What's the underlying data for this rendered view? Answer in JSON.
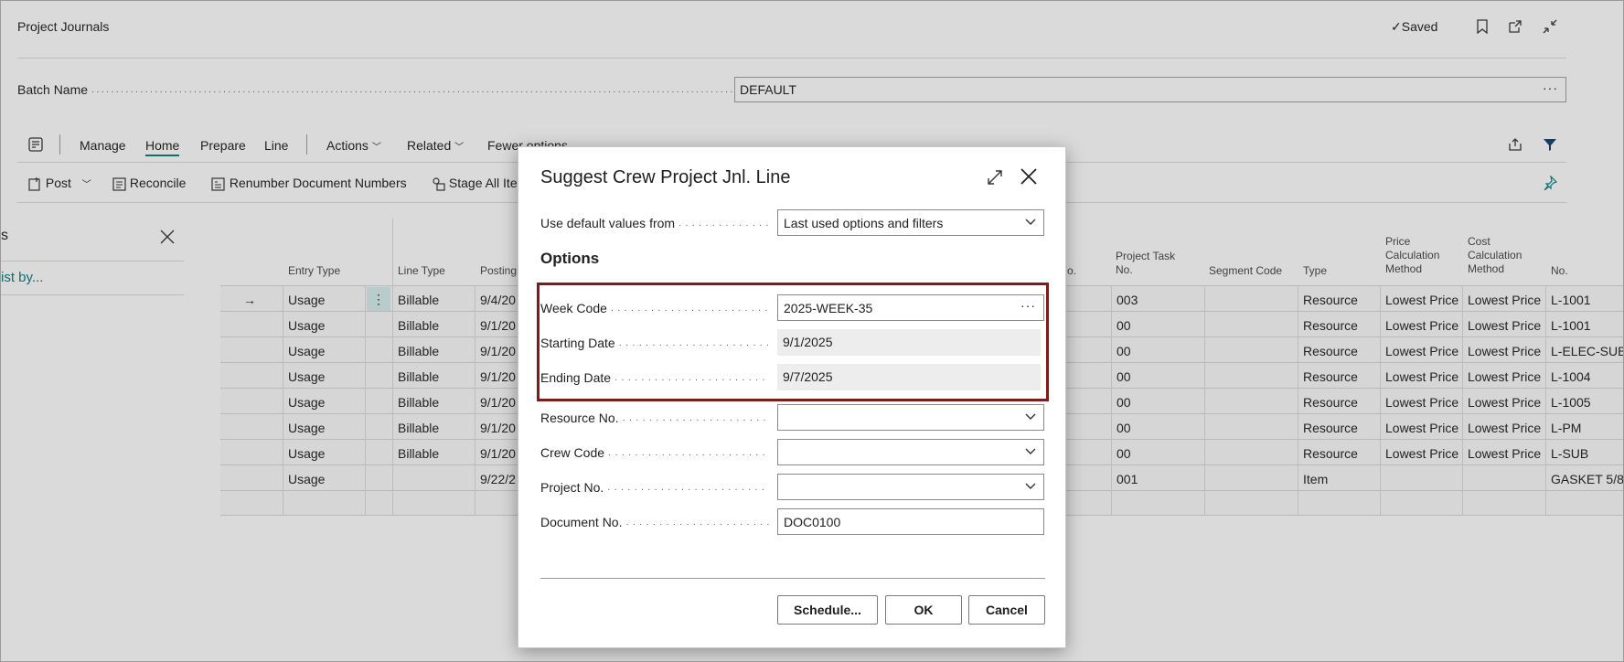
{
  "page": {
    "title": "Project Journals",
    "saved_label": "Saved",
    "batch_label": "Batch Name",
    "batch_value": "DEFAULT",
    "batch_ellipsis": "···"
  },
  "tabs": [
    "Manage",
    "Home",
    "Prepare",
    "Line",
    "Actions",
    "Related",
    "Fewer options"
  ],
  "actions": [
    "Post",
    "Reconcile",
    "Renumber Document Numbers",
    "Stage All Ite"
  ],
  "factbox": {
    "title_fragment": "s",
    "link": "ist by..."
  },
  "grid": {
    "headers": {
      "entry_type": "Entry Type",
      "line_type": "Line Type",
      "posting": "Posting",
      "no_frag": "o.",
      "project_task": [
        "Project Task",
        "No."
      ],
      "segment": "Segment Code",
      "type": "Type",
      "price_calc": [
        "Price",
        "Calculation",
        "Method"
      ],
      "cost_calc": [
        "Cost",
        "Calculation",
        "Method"
      ],
      "no": "No."
    },
    "rows": [
      {
        "entry": "Usage",
        "line": "Billable",
        "posting": "9/4/20",
        "task": "003",
        "type": "Resource",
        "price": "Lowest Price",
        "cost": "Lowest Price",
        "no": "L-1001"
      },
      {
        "entry": "Usage",
        "line": "Billable",
        "posting": "9/1/20",
        "task": "00",
        "type": "Resource",
        "price": "Lowest Price",
        "cost": "Lowest Price",
        "no": "L-1001"
      },
      {
        "entry": "Usage",
        "line": "Billable",
        "posting": "9/1/20",
        "task": "00",
        "type": "Resource",
        "price": "Lowest Price",
        "cost": "Lowest Price",
        "no": "L-ELEC-SUB"
      },
      {
        "entry": "Usage",
        "line": "Billable",
        "posting": "9/1/20",
        "task": "00",
        "type": "Resource",
        "price": "Lowest Price",
        "cost": "Lowest Price",
        "no": "L-1004"
      },
      {
        "entry": "Usage",
        "line": "Billable",
        "posting": "9/1/20",
        "task": "00",
        "type": "Resource",
        "price": "Lowest Price",
        "cost": "Lowest Price",
        "no": "L-1005"
      },
      {
        "entry": "Usage",
        "line": "Billable",
        "posting": "9/1/20",
        "task": "00",
        "type": "Resource",
        "price": "Lowest Price",
        "cost": "Lowest Price",
        "no": "L-PM"
      },
      {
        "entry": "Usage",
        "line": "Billable",
        "posting": "9/1/20",
        "task": "00",
        "type": "Resource",
        "price": "Lowest Price",
        "cost": "Lowest Price",
        "no": "L-SUB"
      },
      {
        "entry": "Usage",
        "line": "",
        "posting": "9/22/2",
        "task": "001",
        "type": "Item",
        "price": "",
        "cost": "",
        "no": "GASKET 5/8"
      },
      {
        "entry": "",
        "line": "",
        "posting": "",
        "task": "",
        "type": "",
        "price": "",
        "cost": "",
        "no": ""
      }
    ]
  },
  "dialog": {
    "title": "Suggest Crew Project Jnl. Line",
    "default_label": "Use default values from",
    "default_value": "Last used options and filters",
    "options_heading": "Options",
    "fields": [
      {
        "label": "Week Code",
        "value": "2025-WEEK-35",
        "kind": "lookup"
      },
      {
        "label": "Starting Date",
        "value": "9/1/2025",
        "kind": "readonly"
      },
      {
        "label": "Ending Date",
        "value": "9/7/2025",
        "kind": "readonly"
      },
      {
        "label": "Resource No.",
        "value": "",
        "kind": "dropdown"
      },
      {
        "label": "Crew Code",
        "value": "",
        "kind": "dropdown"
      },
      {
        "label": "Project No.",
        "value": "",
        "kind": "dropdown"
      },
      {
        "label": "Document No.",
        "value": "DOC0100",
        "kind": "text"
      }
    ],
    "buttons": {
      "schedule": "Schedule...",
      "ok": "OK",
      "cancel": "Cancel"
    }
  },
  "colors": {
    "accent": "#0f6e6e",
    "highlight": "#7a1c1c",
    "overlay": "#dadada"
  }
}
